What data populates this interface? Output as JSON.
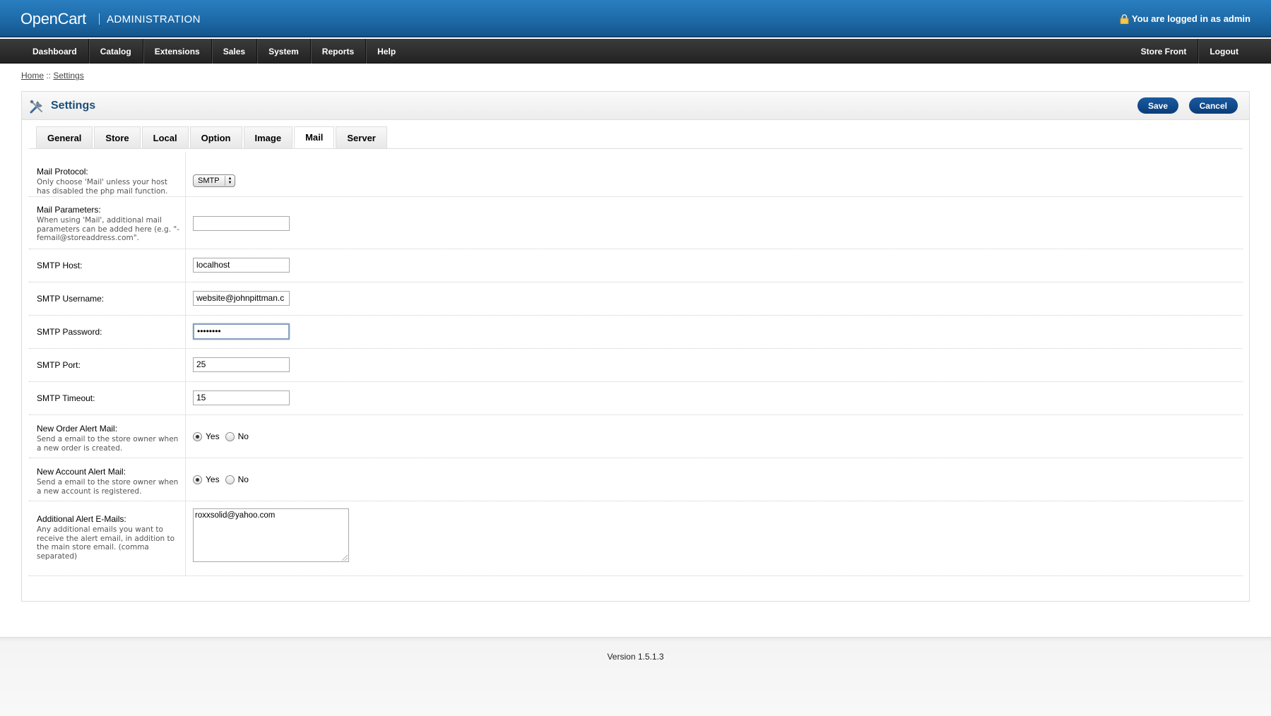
{
  "header": {
    "brand": "OpenCart",
    "subtitle": "ADMINISTRATION",
    "logged_in": "You are logged in as admin"
  },
  "menu": {
    "left": [
      "Dashboard",
      "Catalog",
      "Extensions",
      "Sales",
      "System",
      "Reports",
      "Help"
    ],
    "right": [
      "Store Front",
      "Logout"
    ]
  },
  "breadcrumb": {
    "home": "Home",
    "sep": " :: ",
    "current": "Settings"
  },
  "box": {
    "title": "Settings",
    "save": "Save",
    "cancel": "Cancel"
  },
  "tabs": [
    "General",
    "Store",
    "Local",
    "Option",
    "Image",
    "Mail",
    "Server"
  ],
  "selected_tab": "Mail",
  "form": {
    "mail_protocol": {
      "label": "Mail Protocol:",
      "hint": "Only choose 'Mail' unless your host has disabled the php mail function.",
      "value": "SMTP"
    },
    "mail_parameters": {
      "label": "Mail Parameters:",
      "hint": "When using 'Mail', additional mail parameters can be added here (e.g. \"-femail@storeaddress.com\".",
      "value": ""
    },
    "smtp_host": {
      "label": "SMTP Host:",
      "value": "localhost"
    },
    "smtp_username": {
      "label": "SMTP Username:",
      "value": "website@johnpittman.c"
    },
    "smtp_password": {
      "label": "SMTP Password:",
      "value": "••••••••"
    },
    "smtp_port": {
      "label": "SMTP Port:",
      "value": "25"
    },
    "smtp_timeout": {
      "label": "SMTP Timeout:",
      "value": "15"
    },
    "new_order_alert": {
      "label": "New Order Alert Mail:",
      "hint": "Send a email to the store owner when a new order is created.",
      "yes": "Yes",
      "no": "No",
      "selected": "Yes"
    },
    "new_account_alert": {
      "label": "New Account Alert Mail:",
      "hint": "Send a email to the store owner when a new account is registered.",
      "yes": "Yes",
      "no": "No",
      "selected": "Yes"
    },
    "additional_emails": {
      "label": "Additional Alert E-Mails:",
      "hint": "Any additional emails you want to receive the alert email, in addition to the main store email. (comma separated)",
      "value": "roxxsolid@yahoo.com"
    }
  },
  "footer": {
    "version": "Version 1.5.1.3"
  }
}
